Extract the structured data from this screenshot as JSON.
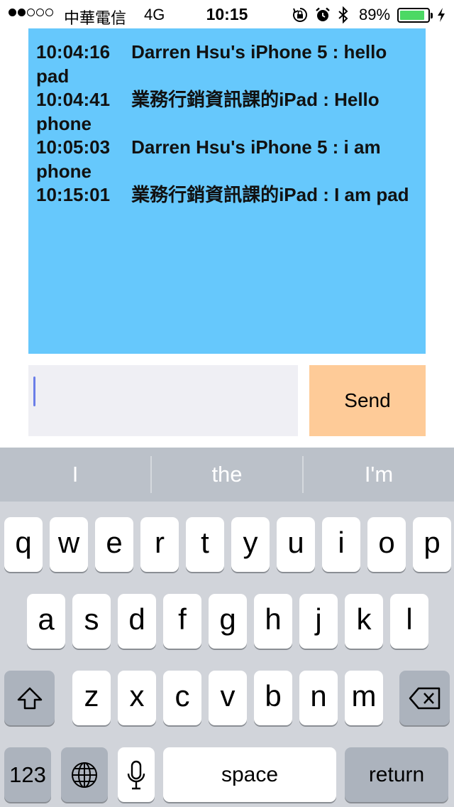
{
  "status_bar": {
    "carrier": "中華電信",
    "network": "4G",
    "time": "10:15",
    "battery_percent": "89%",
    "battery_level": 0.89,
    "signal_bars": 2,
    "icons": [
      "rotation-lock-icon",
      "alarm-icon",
      "bluetooth-icon",
      "battery-icon",
      "charging-icon"
    ],
    "battery_color": "#4cd964"
  },
  "chat": {
    "background_color": "#66c8fc",
    "messages": [
      {
        "time": "10:04:16",
        "text": "Darren Hsu's iPhone 5 : hello pad"
      },
      {
        "time": "10:04:41",
        "text": "業務行銷資訊課的iPad : Hello phone"
      },
      {
        "time": "10:05:03",
        "text": "Darren Hsu's iPhone 5 : i am phone"
      },
      {
        "time": "10:15:01",
        "text": "業務行銷資訊課的iPad : I am pad"
      }
    ]
  },
  "composer": {
    "input_value": "",
    "send_label": "Send",
    "send_color": "#fecb98"
  },
  "keyboard": {
    "suggestions": [
      "I",
      "the",
      "I'm"
    ],
    "row1": [
      "q",
      "w",
      "e",
      "r",
      "t",
      "y",
      "u",
      "i",
      "o",
      "p"
    ],
    "row2": [
      "a",
      "s",
      "d",
      "f",
      "g",
      "h",
      "j",
      "k",
      "l"
    ],
    "row3": [
      "z",
      "x",
      "c",
      "v",
      "b",
      "n",
      "m"
    ],
    "numbers_label": "123",
    "space_label": "space",
    "return_label": "return"
  }
}
